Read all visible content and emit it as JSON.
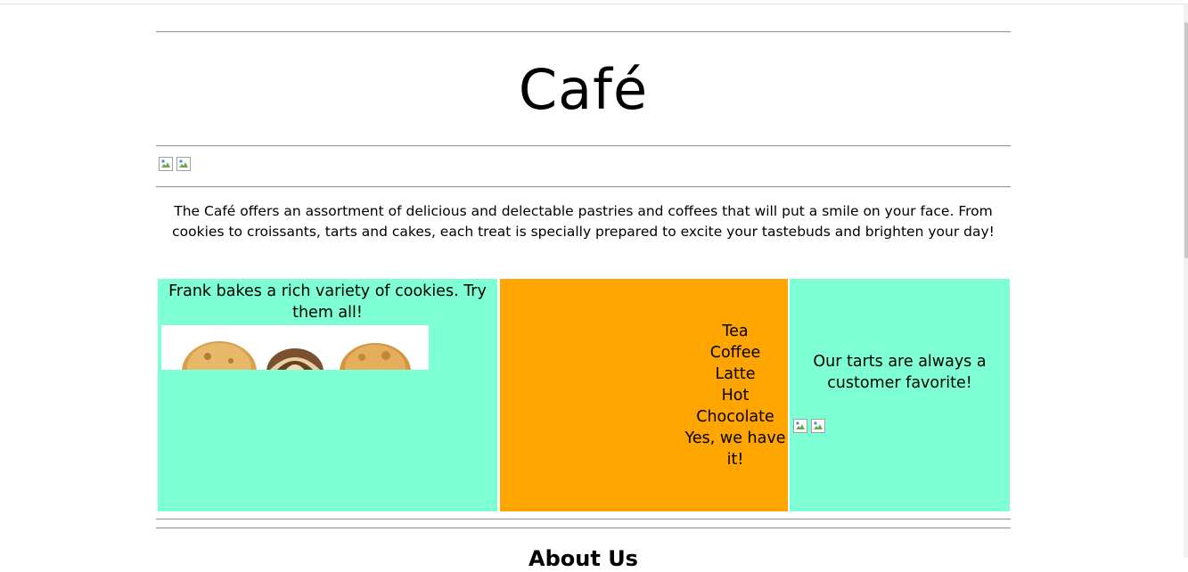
{
  "header": {
    "title": "Café"
  },
  "intro": {
    "text": "The Café offers an assortment of delicious and delectable pastries and coffees that will put a smile on your face. From cookies to croissants, tarts and cakes, each treat is specially prepared to excite your tastebuds and brighten your day!"
  },
  "grid": {
    "cookies": {
      "text": "Frank bakes a rich variety of cookies. Try them all!",
      "bg_color": "#7fffd4"
    },
    "drinks": {
      "items": [
        "Tea",
        "Coffee",
        "Latte",
        "Hot",
        "Chocolate",
        "Yes, we have",
        "it!"
      ],
      "bg_color": "#ffa500"
    },
    "tarts": {
      "text": "Our tarts are always a customer favorite!",
      "bg_color": "#7fffd4"
    }
  },
  "about": {
    "heading": "About Us"
  }
}
